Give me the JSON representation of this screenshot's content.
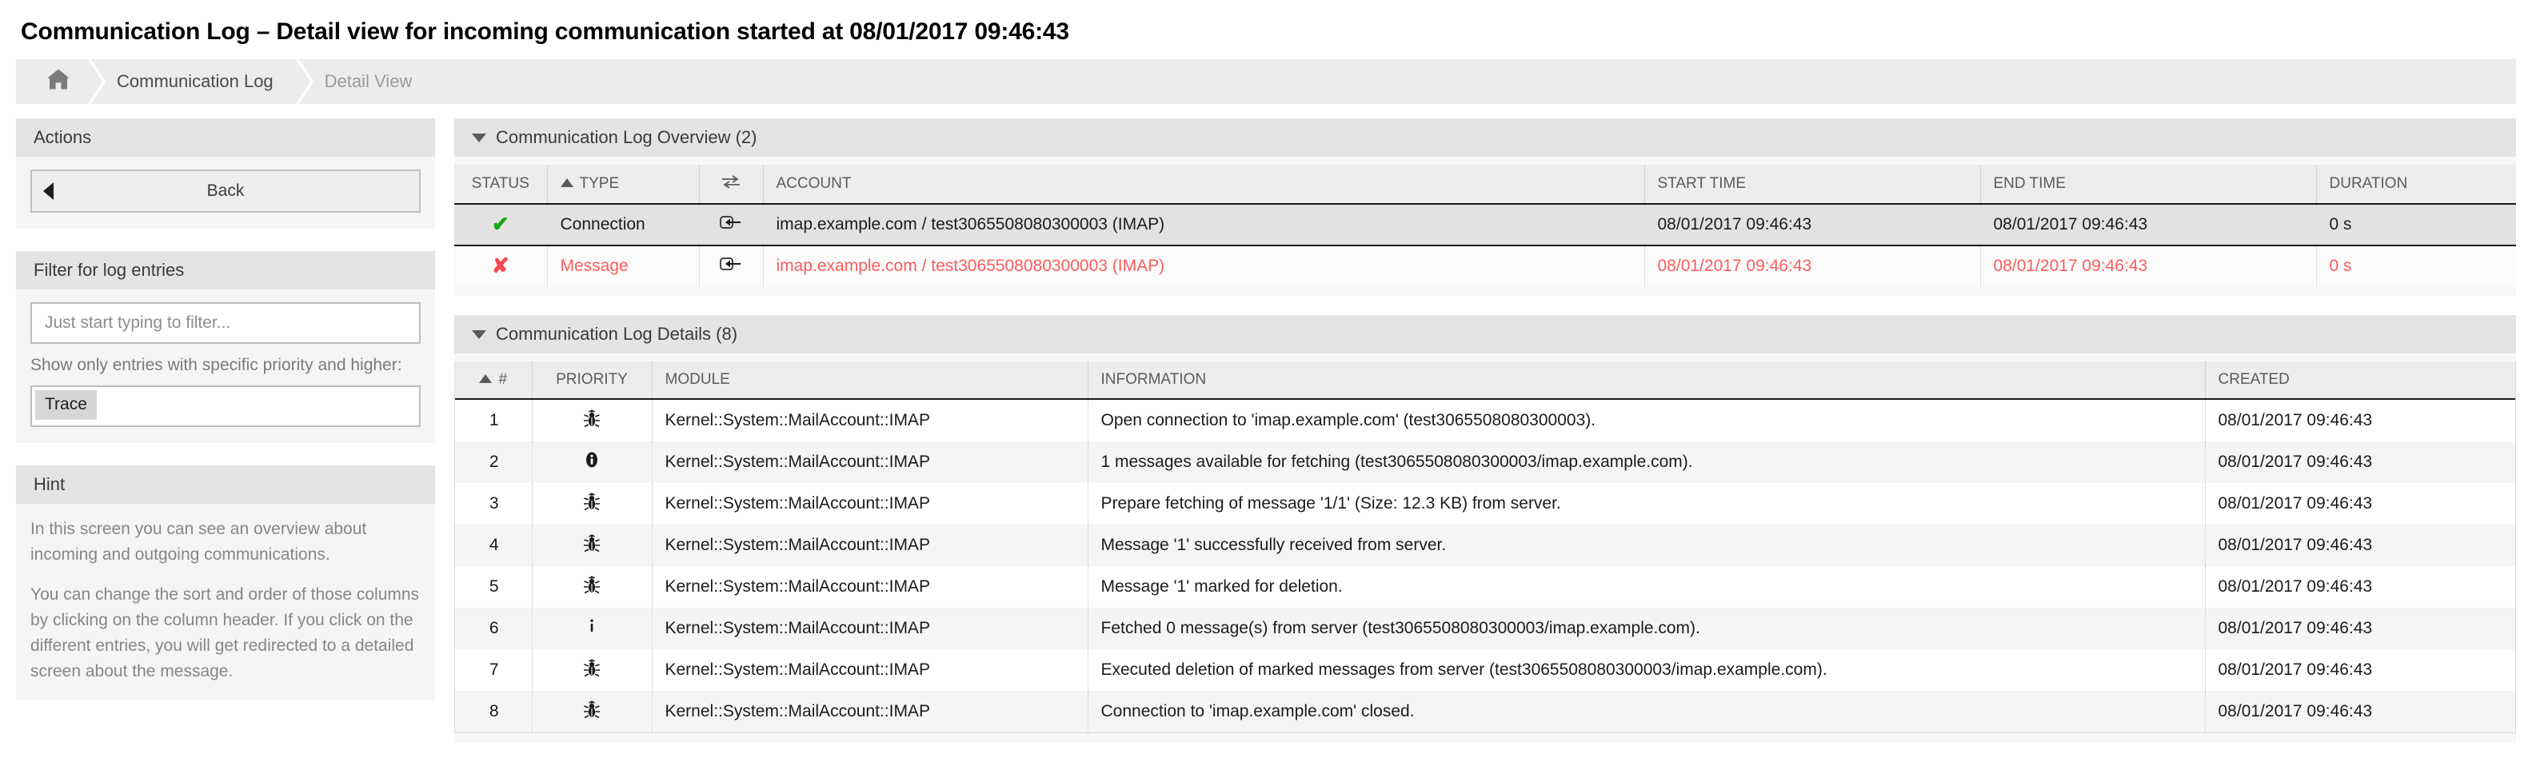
{
  "page": {
    "title": "Communication Log – Detail view for incoming communication started at 08/01/2017 09:46:43"
  },
  "breadcrumb": {
    "home_icon": "home-icon",
    "items": [
      {
        "label": "Communication Log",
        "active": true
      },
      {
        "label": "Detail View",
        "active": false
      }
    ]
  },
  "sidebar": {
    "actions": {
      "header": "Actions",
      "back_label": "Back",
      "back_icon": "caret-left-icon"
    },
    "filter": {
      "header": "Filter for log entries",
      "search_placeholder": "Just start typing to filter...",
      "search_value": "",
      "priority_note": "Show only entries with specific priority and higher:",
      "priority_selected": "Trace",
      "priority_options": [
        "Trace"
      ]
    },
    "hint": {
      "header": "Hint",
      "paragraphs": [
        "In this screen you can see an overview about incoming and outgoing communications.",
        "You can change the sort and order of those columns by clicking on the column header. If you click on the different entries, you will get redirected to a detailed screen about the message."
      ]
    }
  },
  "overview": {
    "header": "Communication Log Overview (2)",
    "collapse_icon": "triangle-down-icon",
    "columns": [
      {
        "key": "status",
        "label": "STATUS"
      },
      {
        "key": "type",
        "label": "TYPE",
        "sort": "asc"
      },
      {
        "key": "direction",
        "label": "",
        "icon": "transfer-arrows-icon"
      },
      {
        "key": "account",
        "label": "ACCOUNT"
      },
      {
        "key": "start_time",
        "label": "START TIME"
      },
      {
        "key": "end_time",
        "label": "END TIME"
      },
      {
        "key": "duration",
        "label": "DURATION"
      }
    ],
    "rows": [
      {
        "status_icon": "check-icon",
        "type": "Connection",
        "direction_icon": "incoming-arrow-icon",
        "account": "imap.example.com / test3065508080300003 (IMAP)",
        "start_time": "08/01/2017 09:46:43",
        "end_time": "08/01/2017 09:46:43",
        "duration": "0 s",
        "state": "active"
      },
      {
        "status_icon": "cross-icon",
        "type": "Message",
        "direction_icon": "incoming-arrow-icon",
        "account": "imap.example.com / test3065508080300003 (IMAP)",
        "start_time": "08/01/2017 09:46:43",
        "end_time": "08/01/2017 09:46:43",
        "duration": "0 s",
        "state": "error"
      }
    ]
  },
  "details": {
    "header": "Communication Log Details (8)",
    "collapse_icon": "triangle-down-icon",
    "columns": [
      {
        "key": "num",
        "label": "#",
        "sort": "asc"
      },
      {
        "key": "priority",
        "label": "PRIORITY"
      },
      {
        "key": "module",
        "label": "MODULE"
      },
      {
        "key": "information",
        "label": "INFORMATION"
      },
      {
        "key": "created",
        "label": "CREATED"
      }
    ],
    "rows": [
      {
        "num": "1",
        "priority_icon": "bug-icon",
        "module": "Kernel::System::MailAccount::IMAP",
        "information": "Open connection to 'imap.example.com' (test3065508080300003).",
        "created": "08/01/2017 09:46:43"
      },
      {
        "num": "2",
        "priority_icon": "info-filled-icon",
        "module": "Kernel::System::MailAccount::IMAP",
        "information": "1 messages available for fetching (test3065508080300003/imap.example.com).",
        "created": "08/01/2017 09:46:43"
      },
      {
        "num": "3",
        "priority_icon": "bug-icon",
        "module": "Kernel::System::MailAccount::IMAP",
        "information": "Prepare fetching of message '1/1' (Size: 12.3 KB) from server.",
        "created": "08/01/2017 09:46:43"
      },
      {
        "num": "4",
        "priority_icon": "bug-icon",
        "module": "Kernel::System::MailAccount::IMAP",
        "information": "Message '1' successfully received from server.",
        "created": "08/01/2017 09:46:43"
      },
      {
        "num": "5",
        "priority_icon": "bug-icon",
        "module": "Kernel::System::MailAccount::IMAP",
        "information": "Message '1' marked for deletion.",
        "created": "08/01/2017 09:46:43"
      },
      {
        "num": "6",
        "priority_icon": "info-thin-icon",
        "module": "Kernel::System::MailAccount::IMAP",
        "information": "Fetched 0 message(s) from server (test3065508080300003/imap.example.com).",
        "created": "08/01/2017 09:46:43"
      },
      {
        "num": "7",
        "priority_icon": "bug-icon",
        "module": "Kernel::System::MailAccount::IMAP",
        "information": "Executed deletion of marked messages from server (test3065508080300003/imap.example.com).",
        "created": "08/01/2017 09:46:43"
      },
      {
        "num": "8",
        "priority_icon": "bug-icon",
        "module": "Kernel::System::MailAccount::IMAP",
        "information": "Connection to 'imap.example.com' closed.",
        "created": "08/01/2017 09:46:43"
      }
    ]
  },
  "colors": {
    "error_text": "#fb5d5d",
    "success_green": "#16a916",
    "error_red": "#f7484e",
    "header_bg": "#e4e4e4",
    "row_active_bg": "#e2e2e2"
  }
}
